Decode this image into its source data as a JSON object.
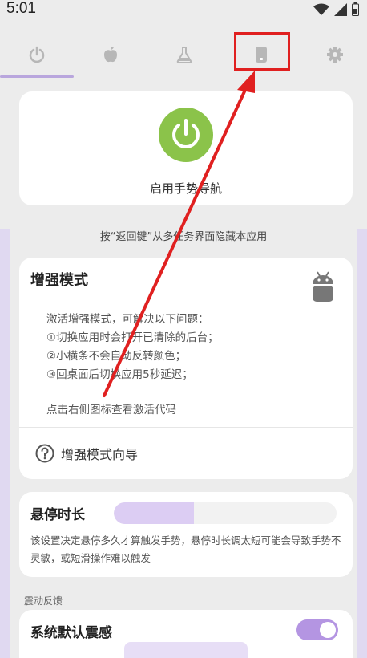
{
  "status_bar": {
    "time": "5:01",
    "icons": [
      "wifi-icon",
      "signal-icon",
      "battery-icon"
    ]
  },
  "tabs": [
    {
      "icon": "power-icon",
      "selected": true
    },
    {
      "icon": "apple-icon",
      "selected": false
    },
    {
      "icon": "flask-icon",
      "selected": false
    },
    {
      "icon": "phone-icon",
      "selected": false,
      "highlighted": true
    },
    {
      "icon": "gear-icon",
      "selected": false
    }
  ],
  "power_card": {
    "label": "启用手势导航",
    "enabled": true,
    "color": "#8bc34a"
  },
  "hint_text": "按“返回键”从多任务界面隐藏本应用",
  "enhance_card": {
    "title": "增强模式",
    "desc_lines": [
      "激活增强模式，可解决以下问题：",
      "①切换应用时会打开已清除的后台；",
      "②小横条不会自动反转颜色；",
      "③回桌面后切换应用5秒延迟；"
    ],
    "code_hint": "点击右侧图标查看激活代码",
    "guide_label": "增强模式向导"
  },
  "hover_card": {
    "title": "悬停时长",
    "slider_fraction": 0.36,
    "desc": "该设置决定悬停多久才算触发手势，悬停时长调太短可能会导致手势不灵敏，或短滑操作难以触发"
  },
  "vibration_section": {
    "label": "震动反馈",
    "item_label": "系统默认震感",
    "enabled": true
  },
  "colors": {
    "accent": "#b495e2",
    "annotation": "#e02020"
  }
}
